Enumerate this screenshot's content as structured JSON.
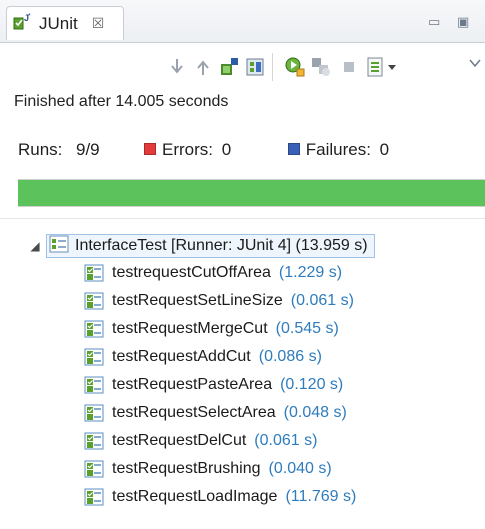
{
  "tab": {
    "title": "JUnit",
    "close_glyph": "☒"
  },
  "window_controls": {
    "minimize": "▭",
    "maximize": "▣"
  },
  "toolbar": {
    "icons": [
      "next-failure-icon",
      "previous-failure-icon",
      "show-failures-only-icon",
      "scroll-lock-icon",
      "rerun-test-icon",
      "rerun-failed-first-icon",
      "stop-icon",
      "history-icon",
      "menu-dropdown-icon",
      "view-menu-icon"
    ]
  },
  "status": {
    "finished_text": "Finished after 14.005 seconds"
  },
  "counters": {
    "runs_label": "Runs:",
    "runs_value": "9/9",
    "errors_label": "Errors:",
    "errors_value": "0",
    "failures_label": "Failures:",
    "failures_value": "0"
  },
  "progress": {
    "fraction": 1.0,
    "color": "#5cc25c"
  },
  "tree": {
    "root": {
      "name": "InterfaceTest [Runner: JUnit 4] (13.959 s)"
    },
    "items": [
      {
        "name": "testrequestCutOffArea",
        "time": "(1.229 s)"
      },
      {
        "name": "testRequestSetLineSize",
        "time": "(0.061 s)"
      },
      {
        "name": "testRequestMergeCut",
        "time": "(0.545 s)"
      },
      {
        "name": "testRequestAddCut",
        "time": "(0.086 s)"
      },
      {
        "name": "testRequestPasteArea",
        "time": "(0.120 s)"
      },
      {
        "name": "testRequestSelectArea",
        "time": "(0.048 s)"
      },
      {
        "name": "testRequestDelCut",
        "time": "(0.061 s)"
      },
      {
        "name": "testRequestBrushing",
        "time": "(0.040 s)"
      },
      {
        "name": "testRequestLoadImage",
        "time": "(11.769 s)"
      }
    ]
  }
}
